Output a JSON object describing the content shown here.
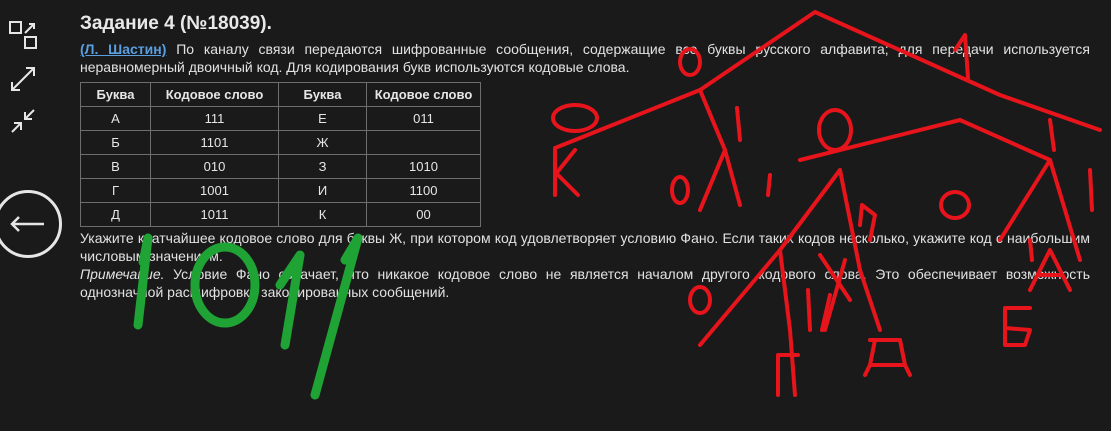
{
  "sidebar": {
    "icons": [
      "collapse-icon",
      "expand-icon",
      "shrink-icon"
    ],
    "back_icon": "arrow-left-icon"
  },
  "task": {
    "title": "Задание 4 (№18039).",
    "author": "(Л. Шастин)",
    "intro": "По каналу связи передаются шифрованные сообщения, содержащие все буквы русского алфавита; для передачи используется неравномерный двоичный код. Для кодирования букв используются кодовые слова.",
    "question": "Укажите кратчайшее кодовое слово для буквы Ж, при котором код удовлетворяет условию Фано. Если таких кодов несколько, укажите код с наибольшим числовым значением.",
    "note_label": "Примечание.",
    "note_text": "Условие Фано означает, что никакое кодовое слово не является началом другого кодового слова. Это обеспечивает возможность однозначной расшифровки закодированных сообщений."
  },
  "table": {
    "headers": [
      "Буква",
      "Кодовое слово",
      "Буква",
      "Кодовое слово"
    ],
    "rows": [
      [
        "А",
        "111",
        "Е",
        "011"
      ],
      [
        "Б",
        "1101",
        "Ж",
        ""
      ],
      [
        "В",
        "010",
        "З",
        "1010"
      ],
      [
        "Г",
        "1001",
        "И",
        "1100"
      ],
      [
        "Д",
        "1011",
        "К",
        "00"
      ]
    ]
  },
  "annotations": {
    "answer_handwritten": "1011",
    "tree_labels": [
      "0",
      "1",
      "0",
      "К",
      "1",
      "0",
      "1",
      "0",
      "1",
      "0",
      "1",
      "0",
      "1",
      "0",
      "1",
      "А",
      "0",
      "1",
      "Б",
      "Г",
      "Д"
    ]
  },
  "colors": {
    "background": "#1a1a1a",
    "text": "#e6e6e6",
    "link": "#5a9fe0",
    "ink_red": "#e8141c",
    "ink_green": "#1fa334"
  }
}
